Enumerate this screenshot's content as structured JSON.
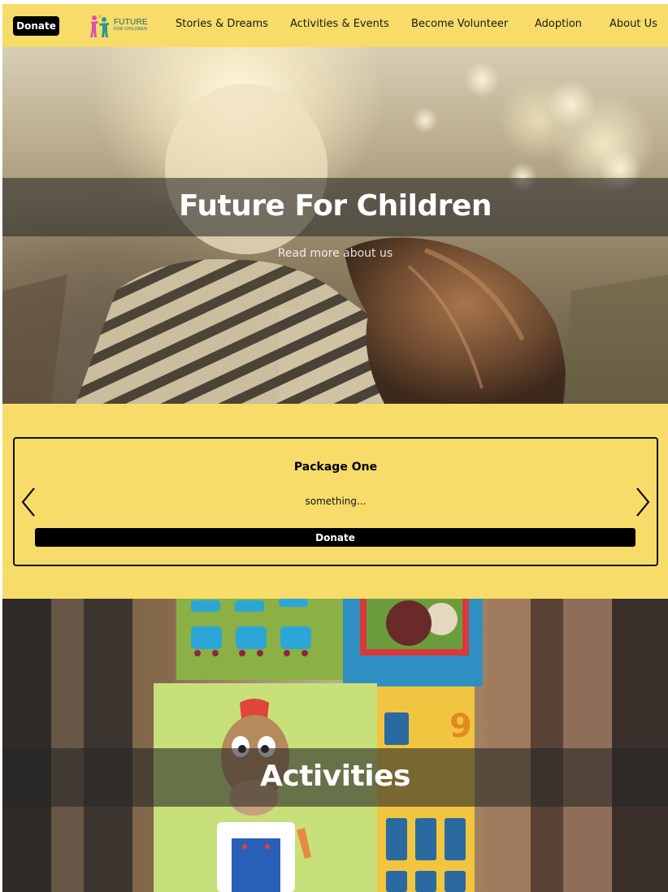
{
  "nav": {
    "donate_label": "Donate",
    "logo": {
      "word": "FUTURE",
      "sub": "FOR CHILDREN"
    },
    "links": [
      "Stories & Dreams",
      "Activities & Events",
      "Become Volunteer",
      "Adoption",
      "About Us"
    ]
  },
  "hero": {
    "title": "Future For Children",
    "link_text": "Read more about us"
  },
  "package": {
    "title": "Package One",
    "description": "something...",
    "donate_label": "Donate",
    "prev_icon": "chevron-left-icon",
    "next_icon": "chevron-right-icon"
  },
  "activities": {
    "title": "Activities"
  },
  "colors": {
    "brand_yellow": "#f7dc6a",
    "button_black": "#000000",
    "overlay": "rgba(40,40,40,0.6)"
  }
}
